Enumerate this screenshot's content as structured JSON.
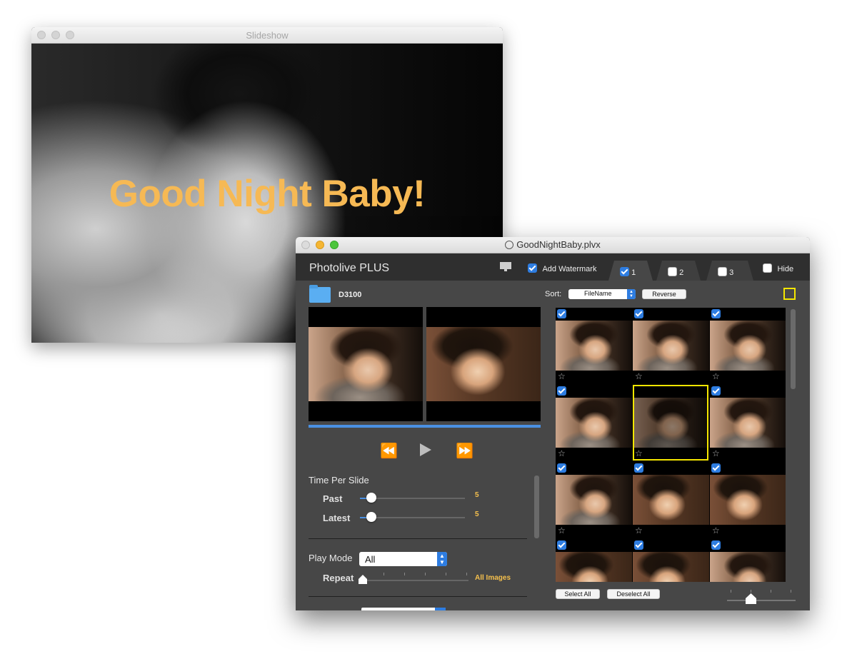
{
  "slideshow": {
    "title": "Slideshow",
    "watermark_text": "Good Night Baby!"
  },
  "main": {
    "title": "GoodNightBaby.plvx",
    "app_name": "Photolive PLUS",
    "add_watermark_label": "Add Watermark",
    "add_watermark_checked": true,
    "tabs": [
      {
        "label": "1",
        "checked": true
      },
      {
        "label": "2",
        "checked": false
      },
      {
        "label": "3",
        "checked": false
      }
    ],
    "hide_label": "Hide",
    "hide_checked": false,
    "folder_name": "D3100",
    "sort_label": "Sort:",
    "sort_value": "FileName",
    "reverse_label": "Reverse",
    "time_per_slide_label": "Time Per Slide",
    "past_label": "Past",
    "past_value": "5",
    "latest_label": "Latest",
    "latest_value": "5",
    "play_mode_label": "Play Mode",
    "play_mode_value": "All",
    "repeat_label": "Repeat",
    "repeat_value": "All Images",
    "select_all_label": "Select All",
    "deselect_all_label": "Deselect All"
  },
  "colors": {
    "accent_blue": "#2e7de1",
    "value_gold": "#f5c04d",
    "highlight_yellow": "#f4e600",
    "watermark_orange": "#f6b954"
  }
}
